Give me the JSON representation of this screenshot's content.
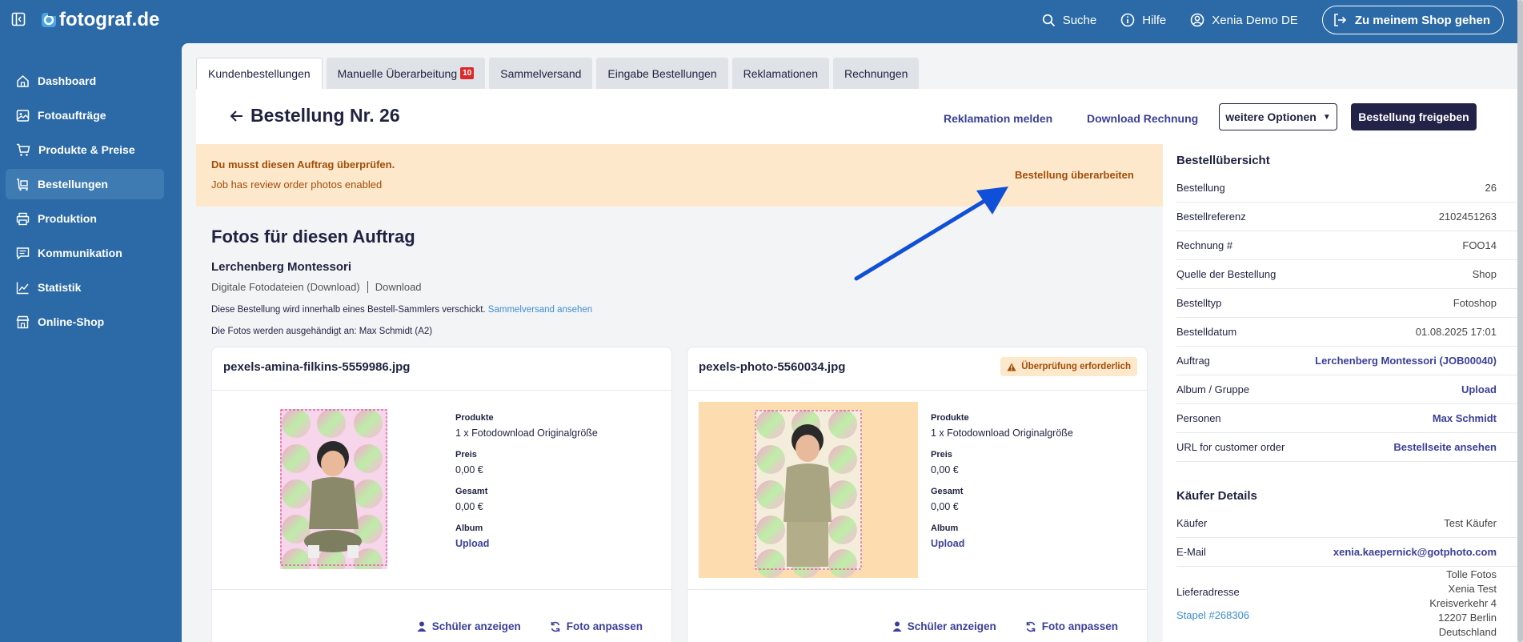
{
  "brand": {
    "name": "fotograf.de",
    "color": "#2b6aa6"
  },
  "topbar": {
    "search": "Suche",
    "help": "Hilfe",
    "user": "Xenia Demo DE",
    "shop_button": "Zu meinem Shop gehen"
  },
  "sidebar": {
    "items": [
      {
        "label": "Dashboard",
        "icon": "home-icon"
      },
      {
        "label": "Fotoaufträge",
        "icon": "image-icon"
      },
      {
        "label": "Produkte & Preise",
        "icon": "cart-icon"
      },
      {
        "label": "Bestellungen",
        "icon": "orders-icon",
        "active": true
      },
      {
        "label": "Produktion",
        "icon": "printer-icon"
      },
      {
        "label": "Kommunikation",
        "icon": "message-icon"
      },
      {
        "label": "Statistik",
        "icon": "chart-icon"
      },
      {
        "label": "Online-Shop",
        "icon": "shop-icon"
      }
    ]
  },
  "tabs": [
    {
      "label": "Kundenbestellungen",
      "active": true
    },
    {
      "label": "Manuelle Überarbeitung",
      "badge": "10"
    },
    {
      "label": "Sammelversand"
    },
    {
      "label": "Eingabe Bestellungen"
    },
    {
      "label": "Reklamationen"
    },
    {
      "label": "Rechnungen"
    }
  ],
  "order": {
    "title": "Bestellung Nr. 26",
    "complaint_link": "Reklamation melden",
    "invoice_link": "Download Rechnung",
    "more_options": "weitere Optionen",
    "release_button": "Bestellung freigeben"
  },
  "alert": {
    "title": "Du musst diesen Auftrag überprüfen.",
    "subtitle": "Job has review order photos enabled",
    "action": "Bestellung überarbeiten"
  },
  "photos_section": {
    "heading": "Fotos für diesen Auftrag",
    "school": "Lerchenberg Montessori",
    "product_type": "Digitale Fotodateien (Download)",
    "delivery": "Download",
    "collector_note": "Diese Bestellung wird innerhalb eines Bestell-Sammlers verschickt.",
    "collector_link": "Sammelversand ansehen",
    "handover_note": "Die Fotos werden ausgehändigt an: Max Schmidt (A2)"
  },
  "cards": [
    {
      "filename": "pexels-amina-filkins-5559986.jpg",
      "products_label": "Produkte",
      "products": "1 x Fotodownload Originalgröße",
      "price_label": "Preis",
      "price": "0,00 €",
      "total_label": "Gesamt",
      "total": "0,00 €",
      "album_label": "Album",
      "album": "Upload",
      "show_student": "Schüler anzeigen",
      "adjust_photo": "Foto anpassen"
    },
    {
      "filename": "pexels-photo-5560034.jpg",
      "warning": "Überprüfung erforderlich",
      "products_label": "Produkte",
      "products": "1 x Fotodownload Originalgröße",
      "price_label": "Preis",
      "price": "0,00 €",
      "total_label": "Gesamt",
      "total": "0,00 €",
      "album_label": "Album",
      "album": "Upload",
      "show_student": "Schüler anzeigen",
      "adjust_photo": "Foto anpassen"
    }
  ],
  "summary": {
    "title": "Bestellübersicht",
    "rows": [
      {
        "k": "Bestellung",
        "v": "26"
      },
      {
        "k": "Bestellreferenz",
        "v": "2102451263"
      },
      {
        "k": "Rechnung #",
        "v": "FOO14"
      },
      {
        "k": "Quelle der Bestellung",
        "v": "Shop"
      },
      {
        "k": "Bestelltyp",
        "v": "Fotoshop"
      },
      {
        "k": "Bestelldatum",
        "v": "01.08.2025 17:01"
      },
      {
        "k": "Auftrag",
        "v": "Lerchenberg Montessori (JOB00040)",
        "link": true
      },
      {
        "k": "Album / Gruppe",
        "v": "Upload",
        "link": true
      },
      {
        "k": "Personen",
        "v": "Max Schmidt",
        "link": true
      },
      {
        "k": "URL for customer order",
        "v": "Bestellseite ansehen",
        "link": true
      }
    ]
  },
  "buyer": {
    "title": "Käufer Details",
    "buyer_label": "Käufer",
    "buyer": "Test Käufer",
    "email_label": "E-Mail",
    "email": "xenia.kaepernick@gotphoto.com",
    "address_label": "Lieferadresse",
    "stack_link": "Stapel #268306",
    "address_lines": [
      "Tolle Fotos",
      "Xenia Test",
      "Kreisverkehr 4",
      "12207 Berlin",
      "Deutschland"
    ]
  }
}
